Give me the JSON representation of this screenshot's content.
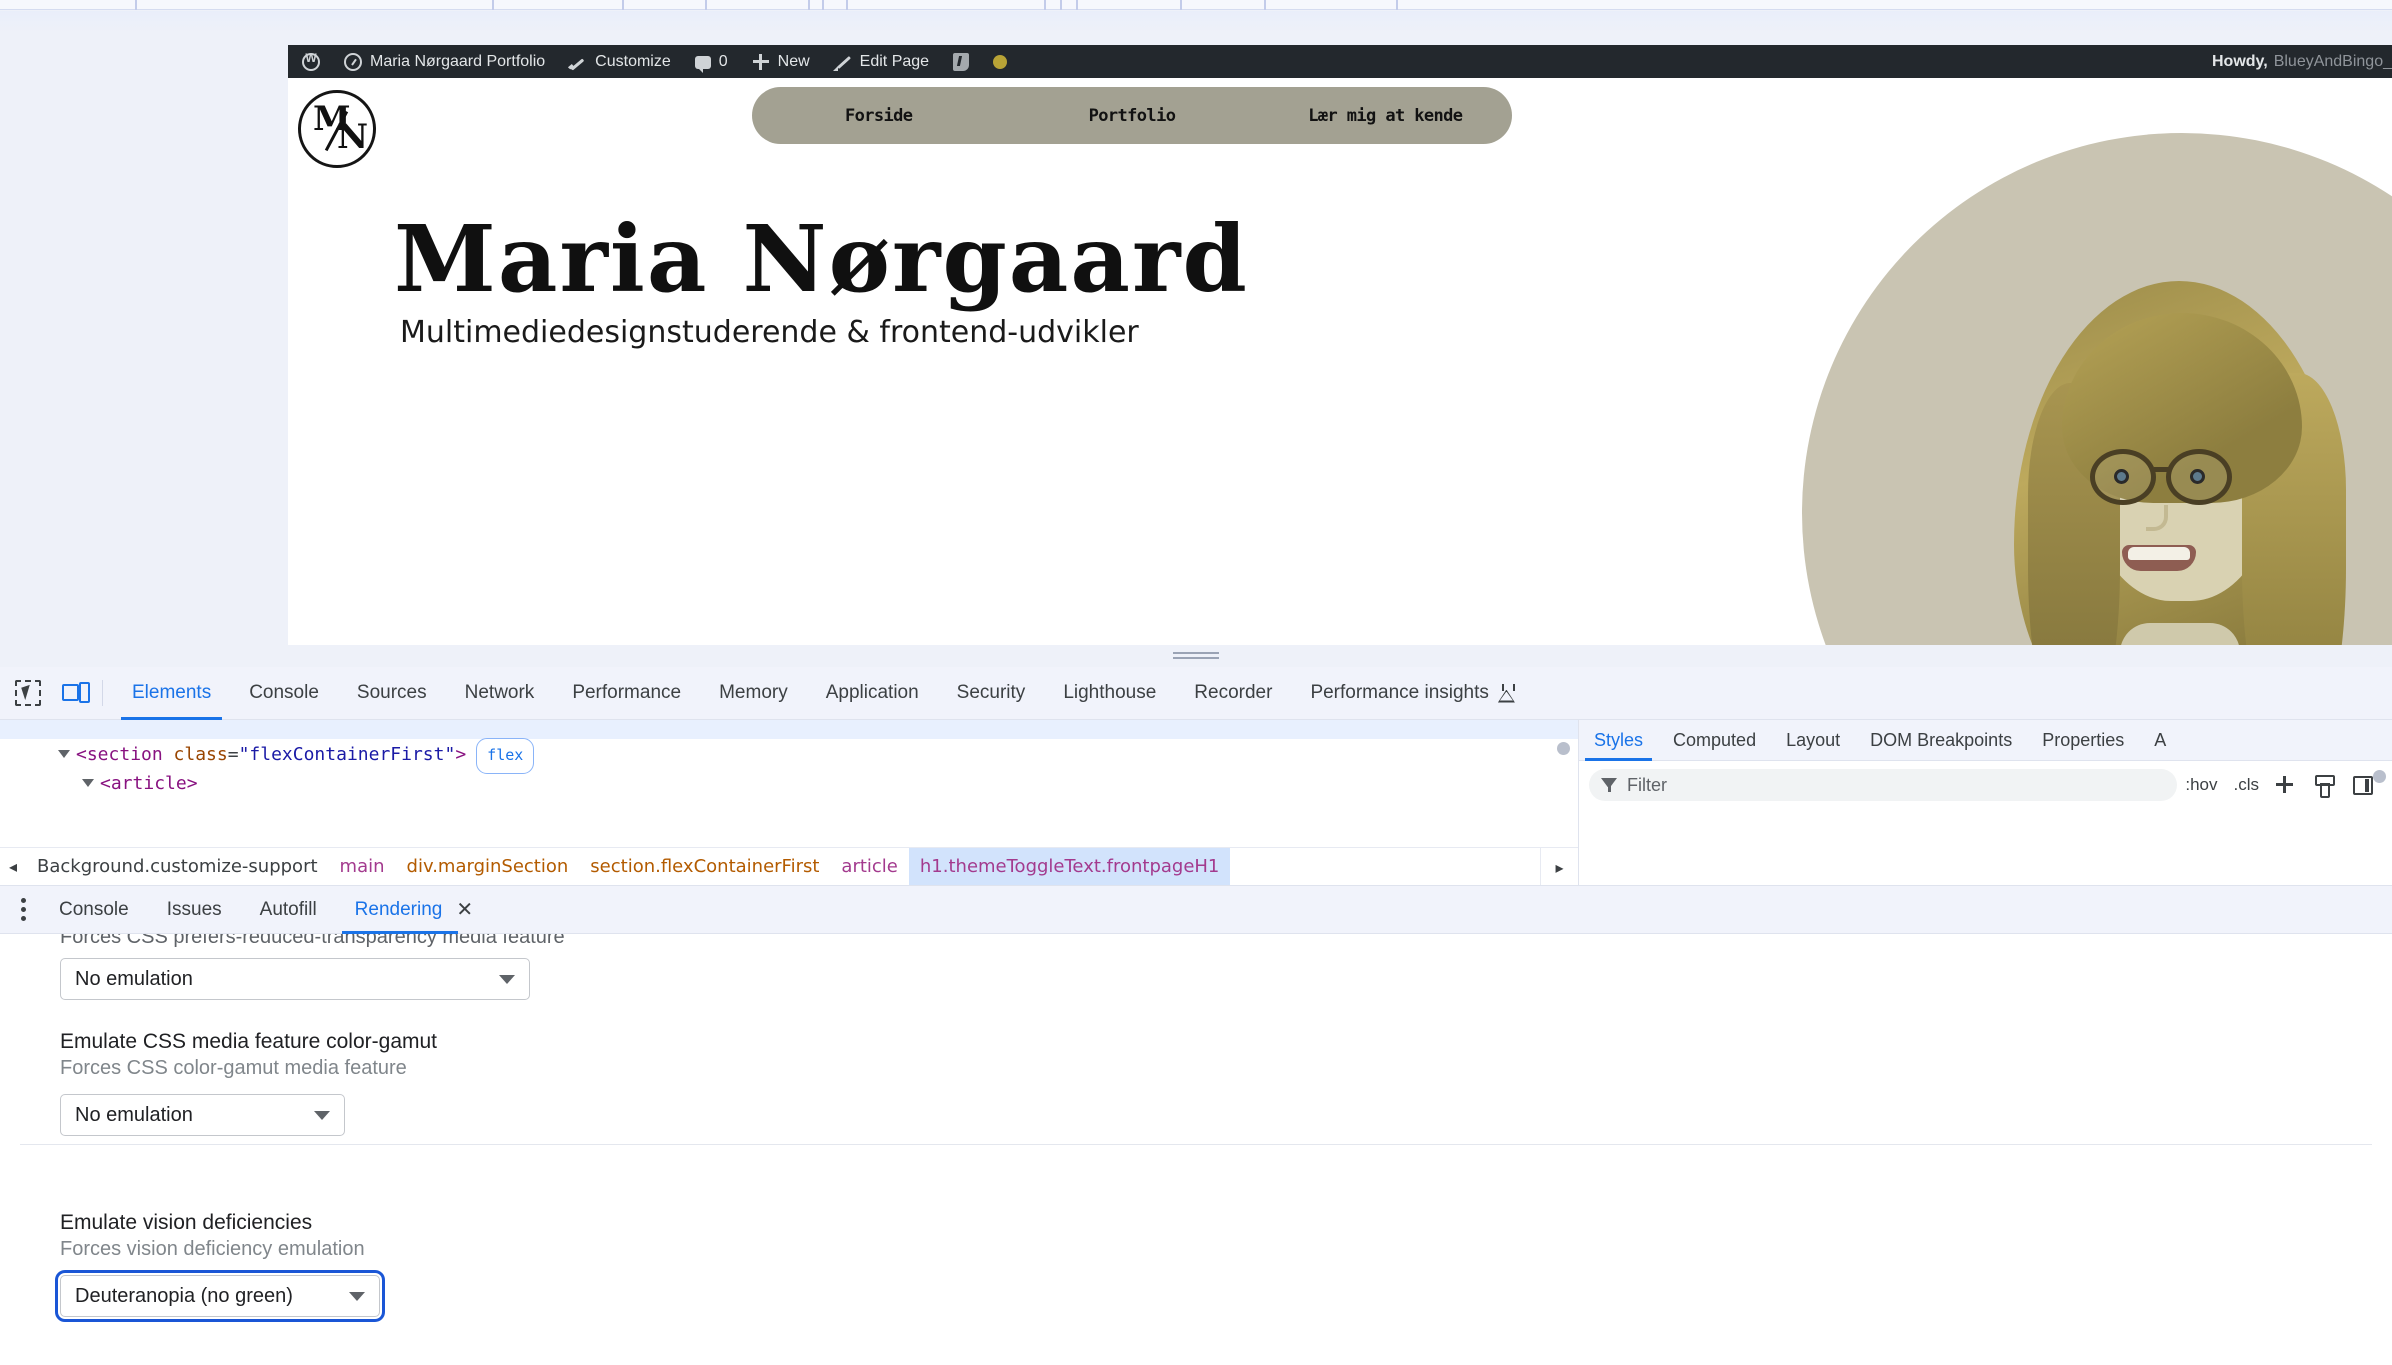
{
  "browser": {
    "tab_strip_ticks": [
      135,
      492,
      622,
      705,
      808,
      822,
      846,
      1044,
      1060,
      1076,
      1180,
      1264,
      1396
    ]
  },
  "site": {
    "adminbar": {
      "items": [
        {
          "icon": "wordpress-logo-icon",
          "label": ""
        },
        {
          "icon": "dashboard-icon",
          "label": "Maria Nørgaard Portfolio"
        },
        {
          "icon": "brush-icon",
          "label": "Customize"
        },
        {
          "icon": "comment-bubble-icon",
          "label": "0"
        },
        {
          "icon": "plus-icon",
          "label": "New"
        },
        {
          "icon": "pencil-icon",
          "label": "Edit Page"
        },
        {
          "icon": "yoast-seo-icon",
          "label": ""
        },
        {
          "icon": "status-dot-icon",
          "label": ""
        }
      ],
      "howdy_label": "Howdy,",
      "howdy_user": "BlueyAndBingo_"
    },
    "logo": {
      "name": "mn-monogram-logo",
      "letters": [
        "M",
        "N"
      ]
    },
    "nav": {
      "background": "#a3a192",
      "items": [
        "Forside",
        "Portfolio",
        "Lær mig at kende"
      ]
    },
    "hero": {
      "title": "Maria Nørgaard",
      "subtitle": "Multimediedesignstuderende & frontend-udvikler",
      "blob_color": "#c9c4b2"
    }
  },
  "devtools": {
    "toolbar": {
      "icons": [
        "inspect-element-icon",
        "device-toolbar-icon"
      ],
      "tabs": [
        {
          "label": "Elements",
          "active": true
        },
        {
          "label": "Console",
          "active": false
        },
        {
          "label": "Sources",
          "active": false
        },
        {
          "label": "Network",
          "active": false
        },
        {
          "label": "Performance",
          "active": false
        },
        {
          "label": "Memory",
          "active": false
        },
        {
          "label": "Application",
          "active": false
        },
        {
          "label": "Security",
          "active": false
        },
        {
          "label": "Lighthouse",
          "active": false
        },
        {
          "label": "Recorder",
          "active": false
        },
        {
          "label": "Performance insights",
          "active": false,
          "icon": "flask-icon"
        }
      ],
      "accent": "#1a73e8"
    },
    "dom_tree": {
      "rows": [
        {
          "indent": 1,
          "caret": true,
          "parts": [
            {
              "text": "<",
              "kind": "punct"
            },
            {
              "text": "section",
              "kind": "tag"
            },
            {
              "text": " class",
              "kind": "attr"
            },
            {
              "text": "=",
              "kind": "plain"
            },
            {
              "text": "\"flexContainerFirst\"",
              "kind": "val"
            },
            {
              "text": ">",
              "kind": "punct"
            }
          ],
          "badge": "flex"
        },
        {
          "indent": 2,
          "caret": true,
          "parts": [
            {
              "text": "<",
              "kind": "punct"
            },
            {
              "text": "article",
              "kind": "tag"
            },
            {
              "text": ">",
              "kind": "punct"
            }
          ],
          "badge": ""
        }
      ]
    },
    "breadcrumb": {
      "left_arrow": "◂",
      "right_arrow": "▸",
      "items": [
        {
          "label": "Background.customize-support",
          "color": "dark",
          "selected": false
        },
        {
          "label": "main",
          "color": "purple",
          "selected": false
        },
        {
          "label": "div.marginSection",
          "color": "orange",
          "selected": false
        },
        {
          "label": "section.flexContainerFirst",
          "color": "orange",
          "selected": false
        },
        {
          "label": "article",
          "color": "purple",
          "selected": false
        },
        {
          "label": "h1.themeToggleText.frontpageH1",
          "color": "mixed",
          "selected": true
        }
      ]
    },
    "styles_sidebar": {
      "tabs": [
        {
          "label": "Styles",
          "active": true
        },
        {
          "label": "Computed",
          "active": false
        },
        {
          "label": "Layout",
          "active": false
        },
        {
          "label": "DOM Breakpoints",
          "active": false
        },
        {
          "label": "Properties",
          "active": false
        },
        {
          "label": "A",
          "active": false
        }
      ],
      "filter_placeholder": "Filter",
      "buttons": [
        ":hov",
        ".cls"
      ],
      "icons": [
        "filter-funnel-icon",
        "new-style-rule-icon",
        "element-classes-icon",
        "computed-sidebar-toggle-icon"
      ]
    },
    "drawer": {
      "menu_icon": "more-options-kebab-icon",
      "tabs": [
        {
          "label": "Console",
          "active": false
        },
        {
          "label": "Issues",
          "active": false
        },
        {
          "label": "Autofill",
          "active": false
        },
        {
          "label": "Rendering",
          "active": true
        }
      ],
      "close_label": "✕"
    },
    "rendering": {
      "clipped_description": "Forces CSS prefers-reduced-transparency media feature",
      "clipped_select_value": "No emulation",
      "sections": [
        {
          "title": "Emulate CSS media feature color-gamut",
          "description": "Forces CSS color-gamut media feature",
          "value": "No emulation",
          "focused": false
        },
        {
          "title": "Emulate vision deficiencies",
          "description": "Forces vision deficiency emulation",
          "value": "Deuteranopia (no green)",
          "focused": true
        }
      ]
    }
  }
}
